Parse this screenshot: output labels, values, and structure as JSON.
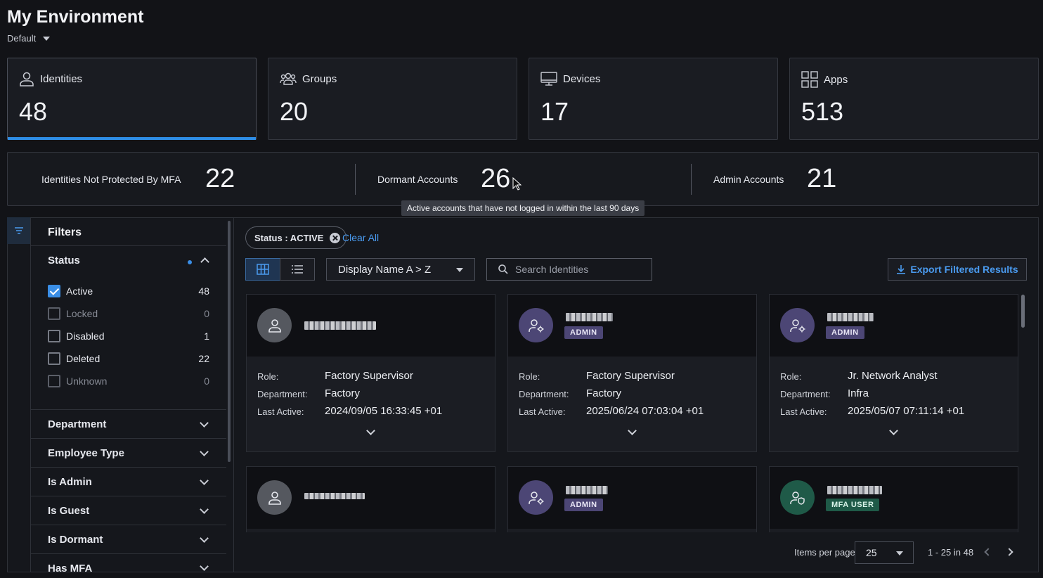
{
  "header": {
    "title": "My Environment",
    "environment": "Default"
  },
  "stats": [
    {
      "label": "Identities",
      "value": "48",
      "icon": "user-icon",
      "active": true
    },
    {
      "label": "Groups",
      "value": "20",
      "icon": "group-icon"
    },
    {
      "label": "Devices",
      "value": "17",
      "icon": "monitor-icon"
    },
    {
      "label": "Apps",
      "value": "513",
      "icon": "apps-grid-icon"
    }
  ],
  "summary": [
    {
      "label": "Identities Not Protected By MFA",
      "value": "22"
    },
    {
      "label": "Dormant Accounts",
      "value": "26"
    },
    {
      "label": "Admin Accounts",
      "value": "21"
    }
  ],
  "tooltip": "Active accounts that have not logged in within the last 90 days",
  "filters": {
    "title": "Filters",
    "status": {
      "title": "Status",
      "options": [
        {
          "label": "Active",
          "count": "48",
          "checked": true
        },
        {
          "label": "Locked",
          "count": "0"
        },
        {
          "label": "Disabled",
          "count": "1"
        },
        {
          "label": "Deleted",
          "count": "22"
        },
        {
          "label": "Unknown",
          "count": "0"
        }
      ]
    },
    "sections": [
      "Department",
      "Employee Type",
      "Is Admin",
      "Is Guest",
      "Is Dormant",
      "Has MFA"
    ]
  },
  "toolbar": {
    "chip": "Status : ACTIVE",
    "clear_all": "Clear All",
    "sort": "Display Name A > Z",
    "search_placeholder": "Search Identities",
    "export": "Export Filtered Results"
  },
  "cards": [
    {
      "type": "user",
      "badge": "",
      "role": "Factory Supervisor",
      "department": "Factory",
      "last_active": "2024/09/05 16:33:45 +01"
    },
    {
      "type": "admin",
      "badge": "ADMIN",
      "role": "Factory Supervisor",
      "department": "Factory",
      "last_active": "2025/06/24 07:03:04 +01"
    },
    {
      "type": "admin",
      "badge": "ADMIN",
      "role": "Jr. Network Analyst",
      "department": "Infra",
      "last_active": "2025/05/07 07:11:14 +01"
    },
    {
      "type": "user",
      "badge": ""
    },
    {
      "type": "admin",
      "badge": "ADMIN"
    },
    {
      "type": "mfa",
      "badge": "MFA USER"
    }
  ],
  "card_labels": {
    "role": "Role:",
    "department": "Department:",
    "last_active": "Last Active:"
  },
  "pagination": {
    "items_per_page_label": "Items per page",
    "items_per_page": "25",
    "range": "1 - 25 in 48"
  }
}
